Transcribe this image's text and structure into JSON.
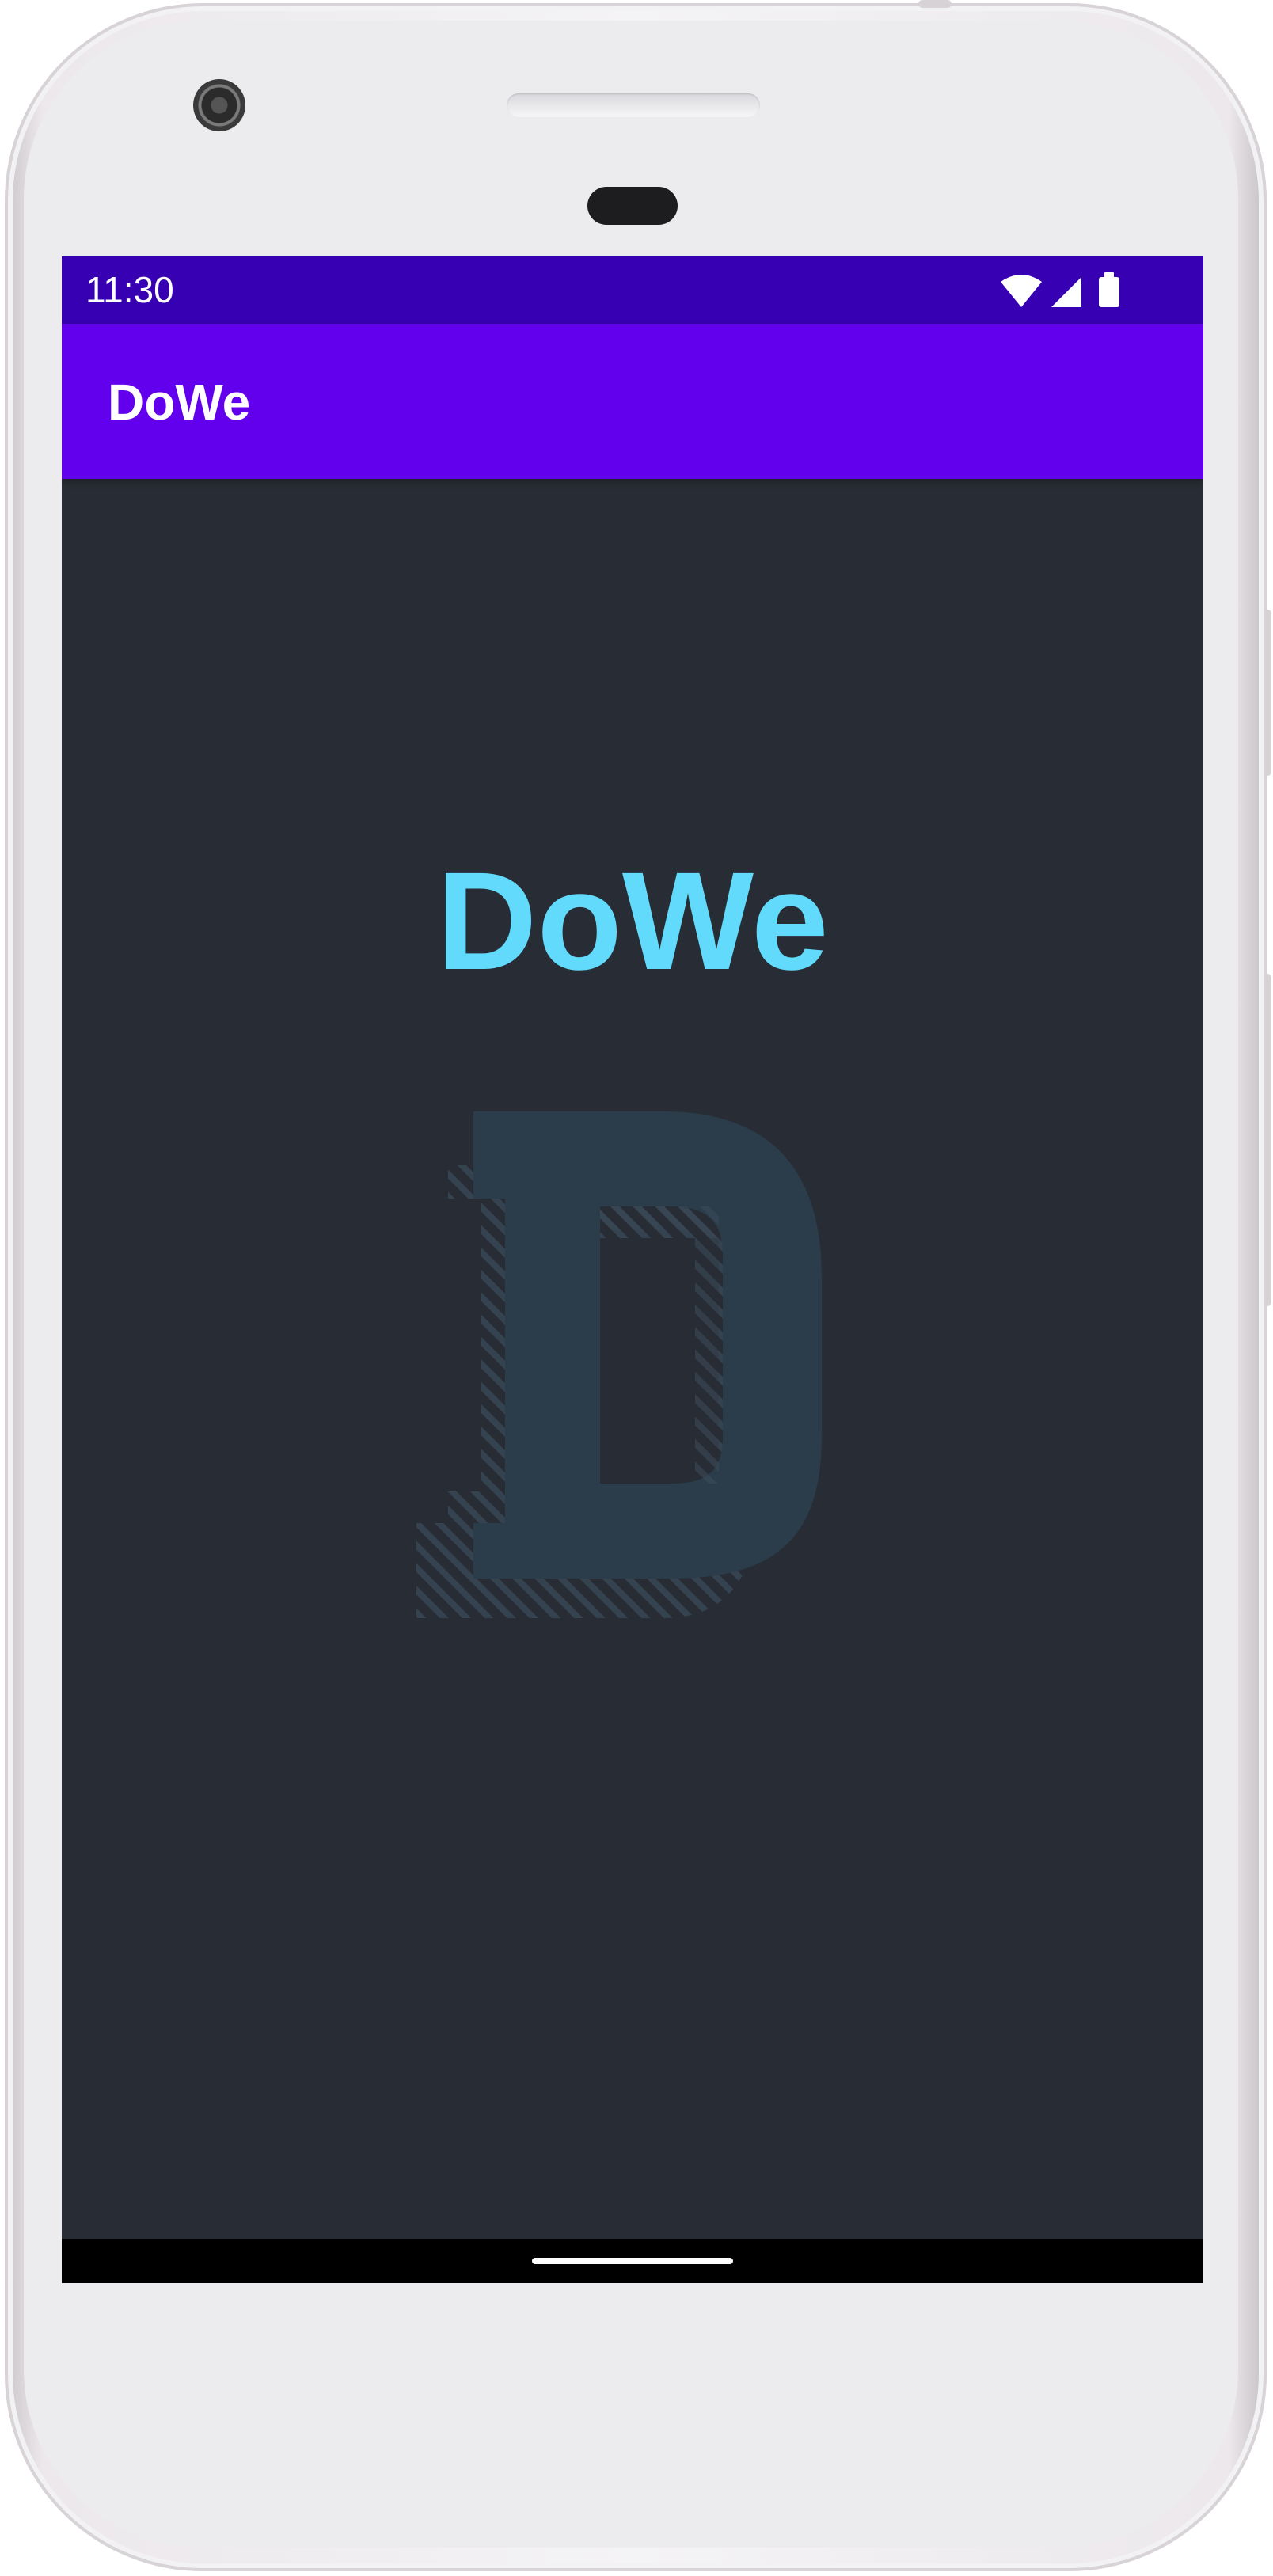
{
  "device": {
    "frame_color": "#f4f3f5"
  },
  "status_bar": {
    "time": "11:30",
    "background_color": "#3700b3",
    "icons": [
      "wifi-icon",
      "signal-icon",
      "battery-icon"
    ]
  },
  "app_bar": {
    "title": "DoWe",
    "background_color": "#6200ee"
  },
  "main": {
    "background_color": "#282c34",
    "headline": "DoWe",
    "headline_color": "#61dafb",
    "logo_icon": "dowe-d-logo-icon"
  },
  "navigation_bar": {
    "background_color": "#000000",
    "home_indicator": "home-indicator"
  }
}
